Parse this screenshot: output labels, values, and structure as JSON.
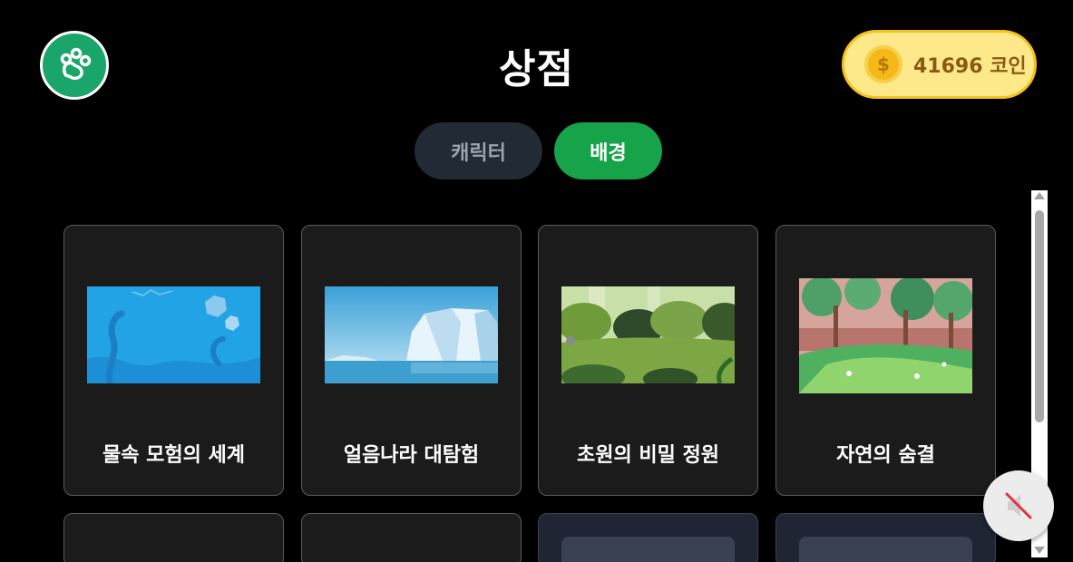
{
  "header": {
    "title": "상점",
    "logo_icon": "paw-icon",
    "coins": {
      "label": "41696 코인",
      "icon": "coin-icon",
      "symbol": "$"
    }
  },
  "tabs": [
    {
      "label": "캐릭터",
      "active": false
    },
    {
      "label": "배경",
      "active": true
    }
  ],
  "items": [
    {
      "name": "물속 모험의 세계",
      "thumbnail": "underwater"
    },
    {
      "name": "얼음나라 대탐험",
      "thumbnail": "iceberg"
    },
    {
      "name": "초원의 비밀 정원",
      "thumbnail": "meadow"
    },
    {
      "name": "자연의 숨결",
      "thumbnail": "forest"
    }
  ],
  "controls": {
    "mute_icon": "speaker-muted-icon"
  },
  "colors": {
    "accent": "#16a34a",
    "coin_bg": "#fde98a",
    "card_bg": "#1b1b1b"
  }
}
